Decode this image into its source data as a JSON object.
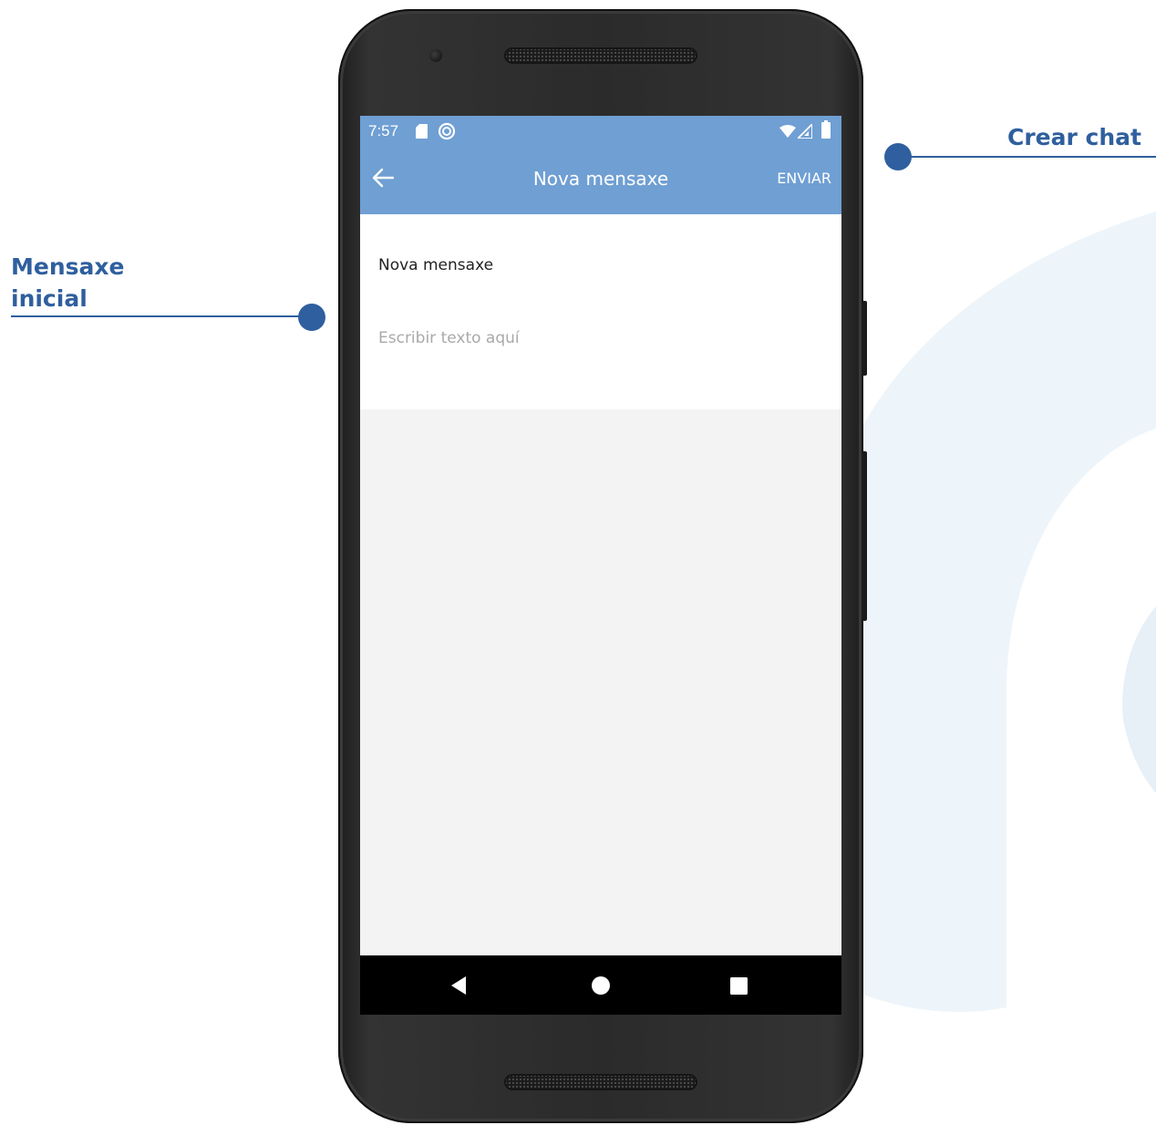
{
  "annotations": {
    "crear_chat": "Crear chat",
    "mensaxe_inicial_line1": "Mensaxe",
    "mensaxe_inicial_line2": "inicial"
  },
  "status_bar": {
    "time": "7:57",
    "icons": [
      "sd-card-icon",
      "sync-icon",
      "wifi-icon",
      "signal-icon",
      "battery-icon"
    ]
  },
  "app_bar": {
    "back_icon": "arrow-left-icon",
    "title": "Nova mensaxe",
    "action_label": "ENVIAR"
  },
  "form": {
    "subject_value": "Nova mensaxe",
    "body_placeholder": "Escribir texto aquí"
  },
  "nav_bar": {
    "icons": [
      "back-triangle-icon",
      "home-circle-icon",
      "recents-square-icon"
    ]
  },
  "colors": {
    "accent": "#6f9fd3",
    "callout": "#2f5f9e",
    "screen_background": "#f3f3f3",
    "nav_bar": "#000000"
  }
}
